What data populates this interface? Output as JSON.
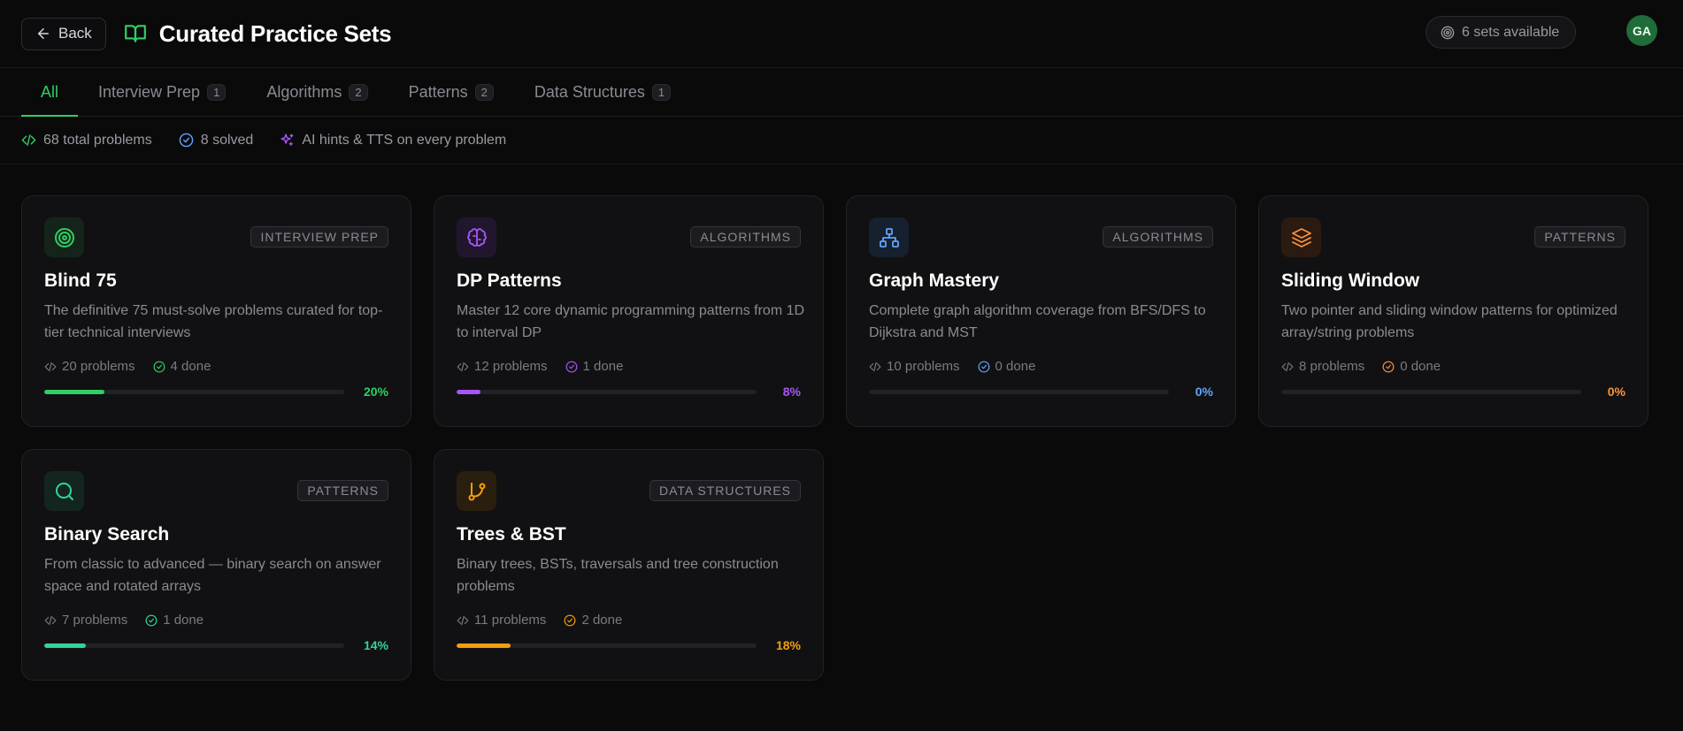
{
  "header": {
    "back_label": "Back",
    "title": "Curated Practice Sets",
    "sets_available": "6 sets available",
    "avatar_initials": "GA"
  },
  "tabs": [
    {
      "label": "All",
      "count": null,
      "active": true
    },
    {
      "label": "Interview Prep",
      "count": "1"
    },
    {
      "label": "Algorithms",
      "count": "2"
    },
    {
      "label": "Patterns",
      "count": "2"
    },
    {
      "label": "Data Structures",
      "count": "1"
    }
  ],
  "stats": {
    "total": "68 total problems",
    "solved": "8 solved",
    "ai": "AI hints & TTS on every problem"
  },
  "colors": {
    "accent_green": "#2fcf63",
    "purple": "#a855f7",
    "blue": "#60a5fa",
    "orange": "#fb923c",
    "teal": "#34d399",
    "amber": "#f59e0b"
  },
  "cards": [
    {
      "title": "Blind 75",
      "category": "Interview Prep",
      "icon": "target-icon",
      "description": "The definitive 75 must-solve problems curated for top-tier technical interviews",
      "problems": "20 problems",
      "done": "4 done",
      "percent": "20%",
      "progress": 0.2
    },
    {
      "title": "DP Patterns",
      "category": "Algorithms",
      "icon": "brain-icon",
      "description": "Master 12 core dynamic programming patterns from 1D to interval DP",
      "problems": "12 problems",
      "done": "1 done",
      "percent": "8%",
      "progress": 0.08
    },
    {
      "title": "Graph Mastery",
      "category": "Algorithms",
      "icon": "network-icon",
      "description": "Complete graph algorithm coverage from BFS/DFS to Dijkstra and MST",
      "problems": "10 problems",
      "done": "0 done",
      "percent": "0%",
      "progress": 0
    },
    {
      "title": "Sliding Window",
      "category": "Patterns",
      "icon": "layers-icon",
      "description": "Two pointer and sliding window patterns for optimized array/string problems",
      "problems": "8 problems",
      "done": "0 done",
      "percent": "0%",
      "progress": 0
    },
    {
      "title": "Binary Search",
      "category": "Patterns",
      "icon": "search-icon",
      "description": "From classic to advanced — binary search on answer space and rotated arrays",
      "problems": "7 problems",
      "done": "1 done",
      "percent": "14%",
      "progress": 0.14
    },
    {
      "title": "Trees & BST",
      "category": "Data Structures",
      "icon": "git-branch-icon",
      "description": "Binary trees, BSTs, traversals and tree construction problems",
      "problems": "11 problems",
      "done": "2 done",
      "percent": "18%",
      "progress": 0.18
    }
  ]
}
